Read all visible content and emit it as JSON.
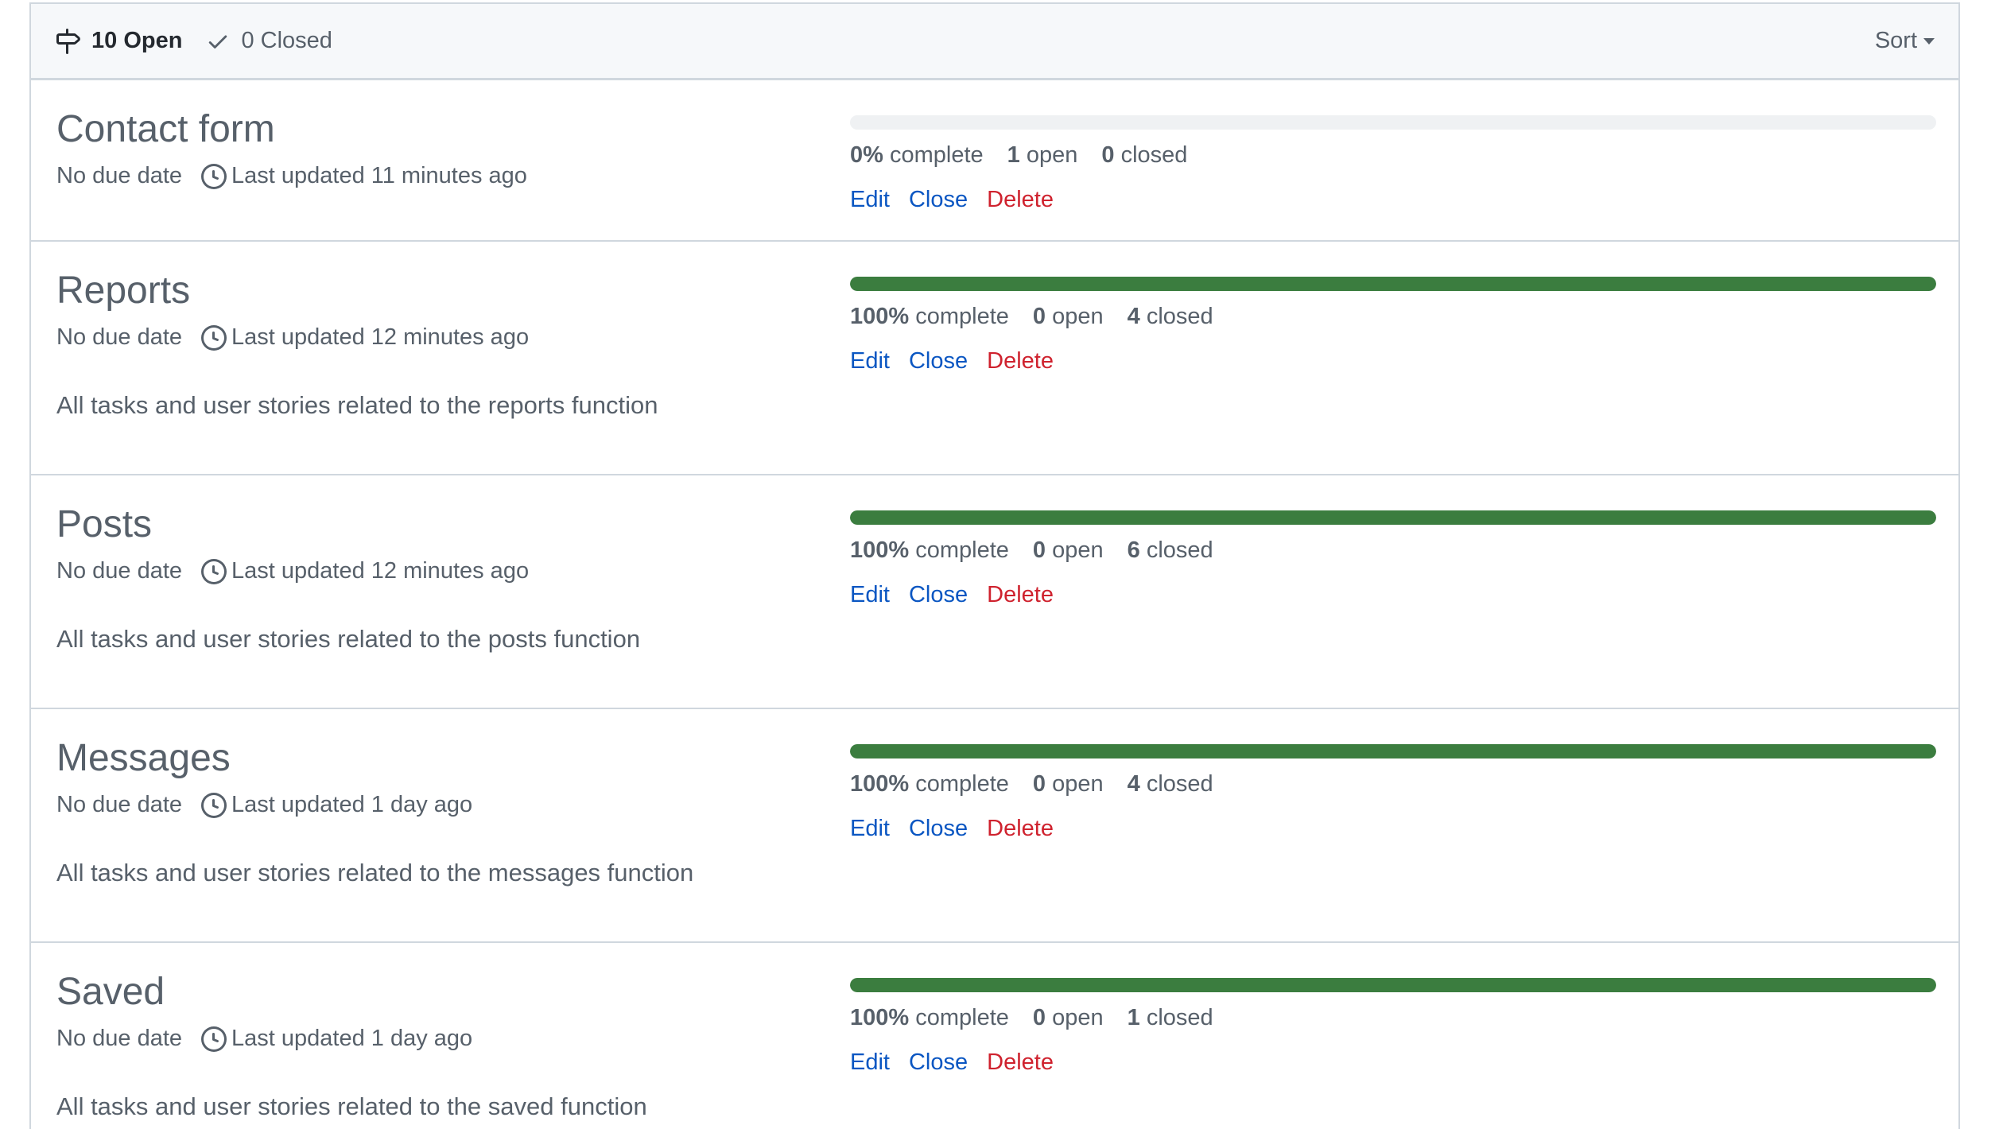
{
  "header": {
    "open_count": "10",
    "open_label": "Open",
    "closed_count": "0",
    "closed_label": "Closed",
    "sort_label": "Sort"
  },
  "labels": {
    "complete": "complete",
    "open": "open",
    "closed": "closed",
    "edit": "Edit",
    "close": "Close",
    "delete": "Delete"
  },
  "milestones": [
    {
      "title": "Contact form",
      "due": "No due date",
      "updated": "Last updated 11 minutes ago",
      "percent": "0%",
      "progress": 0,
      "open": "1",
      "closed": "0",
      "description": ""
    },
    {
      "title": "Reports",
      "due": "No due date",
      "updated": "Last updated 12 minutes ago",
      "percent": "100%",
      "progress": 1,
      "open": "0",
      "closed": "4",
      "description": "All tasks and user stories related to the reports function"
    },
    {
      "title": "Posts",
      "due": "No due date",
      "updated": "Last updated 12 minutes ago",
      "percent": "100%",
      "progress": 1,
      "open": "0",
      "closed": "6",
      "description": "All tasks and user stories related to the posts function"
    },
    {
      "title": "Messages",
      "due": "No due date",
      "updated": "Last updated 1 day ago",
      "percent": "100%",
      "progress": 1,
      "open": "0",
      "closed": "4",
      "description": "All tasks and user stories related to the messages function"
    },
    {
      "title": "Saved",
      "due": "No due date",
      "updated": "Last updated 1 day ago",
      "percent": "100%",
      "progress": 1,
      "open": "0",
      "closed": "1",
      "description": "All tasks and user stories related to the saved function"
    }
  ]
}
